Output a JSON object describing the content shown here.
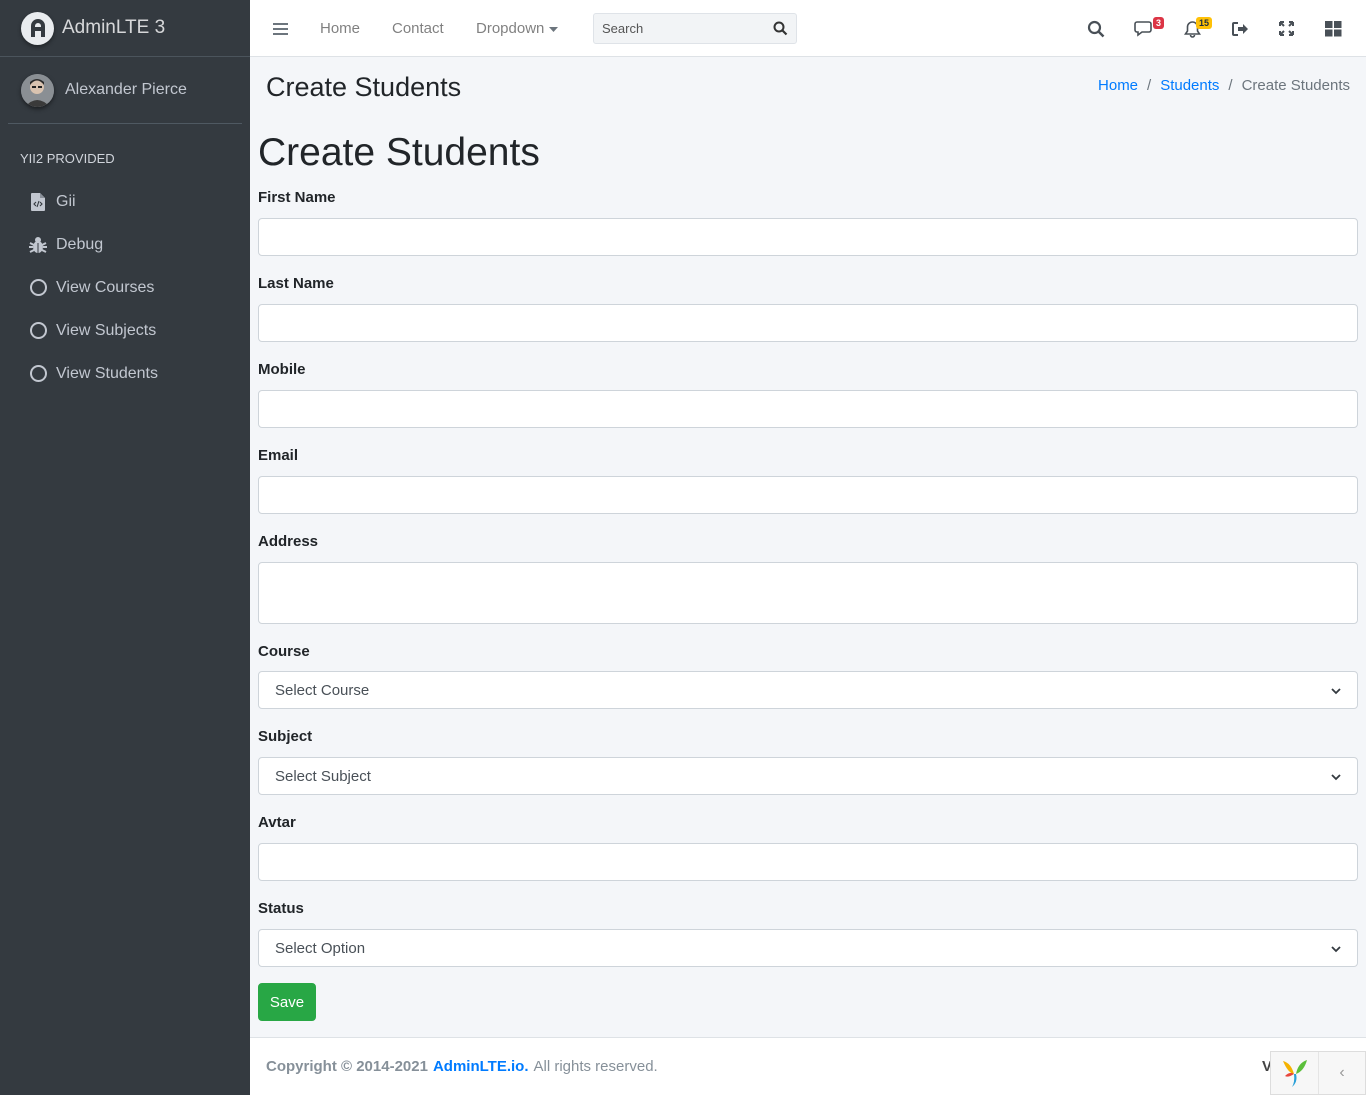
{
  "brand": {
    "name": "AdminLTE 3"
  },
  "user": {
    "name": "Alexander Pierce"
  },
  "sidebar": {
    "header": "Yii2 PROVIDED",
    "items": [
      {
        "label": "Gii",
        "icon": "file-code-icon"
      },
      {
        "label": "Debug",
        "icon": "bug-icon"
      },
      {
        "label": "View Courses",
        "icon": "circle-icon"
      },
      {
        "label": "View Subjects",
        "icon": "circle-icon"
      },
      {
        "label": "View Students",
        "icon": "circle-icon"
      }
    ]
  },
  "topbar": {
    "nav": {
      "home": "Home",
      "contact": "Contact",
      "dropdown": "Dropdown"
    },
    "search": {
      "placeholder": "Search"
    },
    "badges": {
      "messages": "3",
      "notifications": "15"
    }
  },
  "header": {
    "title": "Create Students",
    "breadcrumb": {
      "home": "Home",
      "students": "Students",
      "current": "Create Students"
    }
  },
  "form": {
    "title": "Create Students",
    "fields": {
      "first_name": {
        "label": "First Name",
        "value": ""
      },
      "last_name": {
        "label": "Last Name",
        "value": ""
      },
      "mobile": {
        "label": "Mobile",
        "value": ""
      },
      "email": {
        "label": "Email",
        "value": ""
      },
      "address": {
        "label": "Address",
        "value": ""
      },
      "course": {
        "label": "Course",
        "selected": "Select Course"
      },
      "subject": {
        "label": "Subject",
        "selected": "Select Subject"
      },
      "avtar": {
        "label": "Avtar",
        "value": ""
      },
      "status": {
        "label": "Status",
        "selected": "Select Option"
      }
    },
    "save_label": "Save"
  },
  "footer": {
    "copyright": "Copyright © 2014-2021",
    "link": "AdminLTE.io.",
    "rest": "All rights reserved.",
    "version": "V"
  },
  "colors": {
    "sidebar_bg": "#343a40",
    "primary": "#007bff",
    "success": "#28a745",
    "danger": "#dc3545",
    "warning": "#ffc107"
  }
}
